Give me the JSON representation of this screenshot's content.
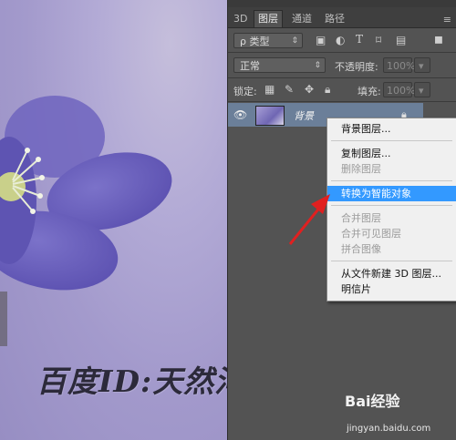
{
  "panel": {
    "tabs": [
      "3D",
      "图层",
      "通道",
      "路径"
    ],
    "menu_button": "≡",
    "filter": {
      "value": "ρ 类型"
    },
    "blend_mode": {
      "value": "正常"
    },
    "opacity": {
      "label": "不透明度:",
      "value": "100%"
    },
    "lock": {
      "label": "锁定:"
    },
    "fill": {
      "label": "填充:",
      "value": "100%"
    }
  },
  "layer": {
    "name": "背景"
  },
  "context_menu": {
    "items": [
      {
        "label": "背景图层...",
        "state": "enabled"
      },
      {
        "label": "复制图层...",
        "state": "enabled"
      },
      {
        "label": "删除图层",
        "state": "disabled"
      },
      {
        "label": "转换为智能对象",
        "state": "highlighted"
      },
      {
        "label": "合并图层",
        "state": "disabled"
      },
      {
        "label": "合并可见图层",
        "state": "disabled"
      },
      {
        "label": "拼合图像",
        "state": "disabled"
      },
      {
        "label": "从文件新建 3D 图层...",
        "state": "enabled"
      },
      {
        "label": "明信片",
        "state": "enabled"
      }
    ]
  },
  "watermark": {
    "text": "百度ID:天然河与你相约"
  },
  "baidu": {
    "logo_text": "Bai经验",
    "url": "jingyan.baidu.com"
  },
  "colors": {
    "highlight": "#3399ff",
    "arrow": "#e02020",
    "panel_bg": "#535353"
  }
}
